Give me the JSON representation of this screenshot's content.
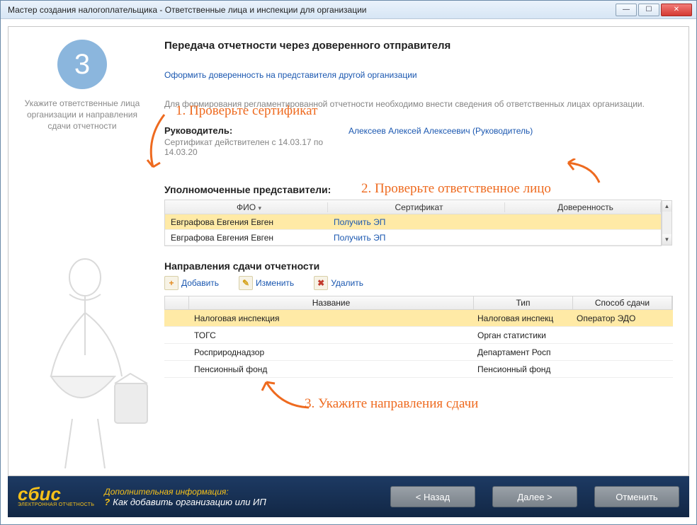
{
  "window": {
    "title": "Мастер создания налогоплательщика - Ответственные лица и инспекции для организации"
  },
  "sidebar": {
    "step_number": "3",
    "hint": "Укажите ответственные лица организации и направления сдачи отчетности"
  },
  "main": {
    "heading": "Передача отчетности через доверенного отправителя",
    "link_proxy": "Оформить доверенность на представителя другой организации",
    "desc": "Для формирования регламентированной отчетности необходимо внести сведения об ответственных лицах организации.",
    "leader_label": "Руководитель:",
    "cert_validity": "Сертификат действителен с 14.03.17 по 14.03.20",
    "leader_name": "Алексеев Алексей Алексеевич (Руководитель)",
    "reps_heading": "Уполномоченные представители:",
    "reps_columns": {
      "fio": "ФИО",
      "cert": "Сертификат",
      "pow": "Доверенность"
    },
    "reps": [
      {
        "fio": "Евграфова Евгения Евген",
        "cert_action": "Получить ЭП"
      },
      {
        "fio": "Евграфова Евгения Евген",
        "cert_action": "Получить ЭП"
      }
    ],
    "dirs_heading": "Направления сдачи отчетности",
    "toolbar": {
      "add": "Добавить",
      "edit": "Изменить",
      "del": "Удалить"
    },
    "dirs_columns": {
      "name": "Название",
      "type": "Тип",
      "method": "Способ сдачи"
    },
    "dirs": [
      {
        "name": "Налоговая инспекция",
        "type": "Налоговая инспекц",
        "method": "Оператор ЭДО"
      },
      {
        "name": "ТОГС",
        "type": "Орган статистики",
        "method": ""
      },
      {
        "name": "Росприроднадзор",
        "type": "Департамент Росп",
        "method": ""
      },
      {
        "name": "Пенсионный фонд",
        "type": "Пенсионный фонд",
        "method": ""
      }
    ]
  },
  "annotations": {
    "a1": "1. Проверьте сертификат",
    "a2": "2. Проверьте ответственное лицо",
    "a3": "3. Укажите направления сдачи"
  },
  "footer": {
    "logo": "сбис",
    "logo_sub": "ЭЛЕКТРОННАЯ ОТЧЕТНОСТЬ",
    "info_title": "Дополнительная информация:",
    "info_link": "Как добавить организацию или ИП",
    "back": "< Назад",
    "next": "Далее >",
    "cancel": "Отменить"
  }
}
